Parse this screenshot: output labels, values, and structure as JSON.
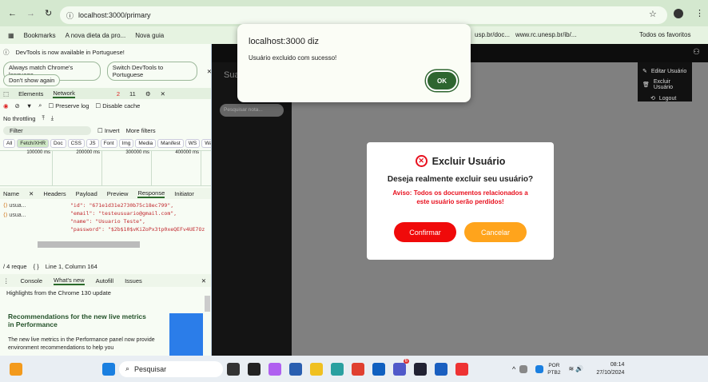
{
  "browser": {
    "url": "localhost:3000/primary",
    "bookmarks": [
      "Bookmarks",
      "A nova dieta da pro...",
      "Nova guia",
      "usp.br/doc...",
      "www.rc.unesp.br/ib/...",
      "Todos os favoritos"
    ]
  },
  "alert": {
    "title": "localhost:3000 diz",
    "message": "Usuário excluido com sucesso!",
    "ok": "OK"
  },
  "devtools": {
    "notice": "DevTools is now available in Portuguese!",
    "btn_match": "Always match Chrome's language",
    "btn_switch": "Switch DevTools to Portuguese",
    "btn_dont": "Don't show again",
    "tabs": [
      "Elements",
      "Network"
    ],
    "errors": "2",
    "messages": "11",
    "preserve": "Preserve log",
    "disable_cache": "Disable cache",
    "throttle": "No throttling",
    "filter": "Filter",
    "invert": "Invert",
    "more_filters": "More filters",
    "types": [
      "All",
      "Fetch/XHR",
      "Doc",
      "CSS",
      "JS",
      "Font",
      "Img",
      "Media",
      "Manifest",
      "WS",
      "Wasm"
    ],
    "timeline": [
      "100000 ms",
      "200000 ms",
      "300000 ms",
      "400000 ms"
    ],
    "detail_tabs": [
      "Name",
      "Headers",
      "Payload",
      "Preview",
      "Response",
      "Initiator"
    ],
    "requests": [
      "usua...",
      "usua..."
    ],
    "response": [
      "\"id\": \"671e1d31e2730b75c18ec799\",",
      "\"email\": \"testeusuario@gmail.com\",",
      "\"name\": \"Usuario Teste\",",
      "\"password\": \"$2b$10$vKiZoPx3tp0xeQEFv4UE7Oz:",
      "}"
    ],
    "status_req": "/ 4 reque",
    "status_pos": "Line 1, Column 164",
    "drawer_tabs": [
      "Console",
      "What's new",
      "Autofill",
      "Issues"
    ],
    "highlights": "Highlights from the Chrome 130 update",
    "article_title": "Recommendations for the new live metrics in Performance",
    "article_body": "The new live metrics in the Performance panel now provide environment recommendations to help you"
  },
  "app": {
    "sidebar_title": "Sua",
    "search_placeholder": "Pesquisar nota...",
    "menu": [
      "Editar Usuário",
      "Excluir Usuário",
      "Logout"
    ]
  },
  "modal": {
    "title": "Excluir Usuário",
    "question": "Deseja realmente excluir seu usuário?",
    "warning": "Aviso: Todos os documentos relacionados a este usuário serão perdidos!",
    "confirm": "Confirmar",
    "cancel": "Cancelar",
    "colors": {
      "confirm": "#f00a0a",
      "cancel": "#ffa41c",
      "warning": "#e8101e"
    }
  },
  "taskbar": {
    "search": "Pesquisar",
    "lang1": "POR",
    "lang2": "PTB2",
    "time": "08:14",
    "date": "27/10/2024",
    "teams_badge": "6"
  }
}
